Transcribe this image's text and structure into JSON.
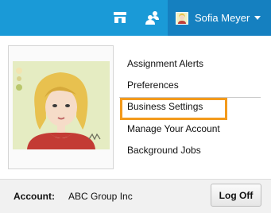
{
  "topbar": {
    "icons": [
      "store-icon",
      "people-icon"
    ],
    "user": {
      "name": "Sofia Meyer",
      "caret_icon": "chevron-down-icon"
    },
    "background_color": "#1a9ad7",
    "user_menu_color": "#1580c0"
  },
  "menu": {
    "items": [
      {
        "label": "Assignment Alerts"
      },
      {
        "label": "Preferences"
      },
      {
        "label": "Business Settings",
        "highlighted": true
      },
      {
        "label": "Manage Your Account"
      },
      {
        "label": "Background Jobs"
      }
    ],
    "highlight_color": "#f39a1c"
  },
  "footer": {
    "account_label": "Account:",
    "account_value": "ABC Group Inc",
    "logoff_label": "Log Off"
  }
}
